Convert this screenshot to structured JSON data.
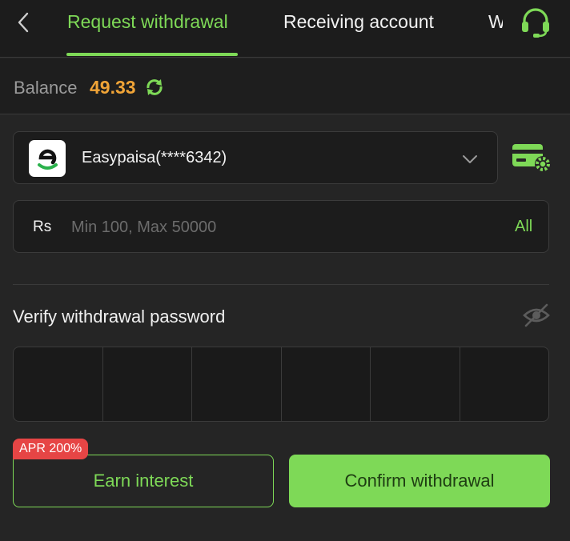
{
  "header": {
    "tabs": [
      {
        "label": "Request withdrawal",
        "active": true
      },
      {
        "label": "Receiving account",
        "active": false
      },
      {
        "label": "W",
        "active": false
      }
    ],
    "back_icon": "chevron-left-icon",
    "support_icon": "headset-icon"
  },
  "balance": {
    "label": "Balance",
    "value": "49.33",
    "refresh_icon": "refresh-icon"
  },
  "account": {
    "name": "Easypaisa(****6342)",
    "logo_icon": "easypaisa-logo",
    "dropdown_icon": "chevron-down-icon",
    "settings_icon": "card-settings-icon"
  },
  "amount": {
    "currency": "Rs",
    "placeholder": "Min 100, Max 50000",
    "all_label": "All"
  },
  "password": {
    "label": "Verify withdrawal password",
    "visibility_icon": "eye-off-icon",
    "digits": [
      "",
      "",
      "",
      "",
      "",
      ""
    ]
  },
  "actions": {
    "apr_badge": "APR 200%",
    "earn_label": "Earn interest",
    "confirm_label": "Confirm withdrawal"
  },
  "colors": {
    "accent": "#7ed957",
    "balance": "#f0a437",
    "badge": "#e64545",
    "background": "#252525"
  }
}
